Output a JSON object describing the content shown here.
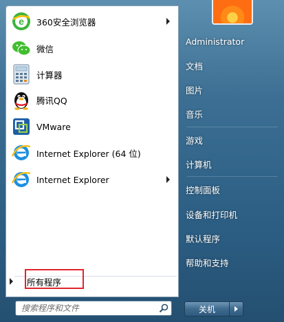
{
  "programs": [
    {
      "label": "360安全浏览器",
      "icon": "360-browser-icon",
      "has_submenu": true
    },
    {
      "label": "微信",
      "icon": "wechat-icon",
      "has_submenu": false
    },
    {
      "label": "计算器",
      "icon": "calculator-icon",
      "has_submenu": false
    },
    {
      "label": "腾讯QQ",
      "icon": "qq-penguin-icon",
      "has_submenu": false
    },
    {
      "label": "VMware",
      "icon": "vmware-icon",
      "has_submenu": false
    },
    {
      "label": "Internet Explorer (64 位)",
      "icon": "internet-explorer-icon",
      "has_submenu": false
    },
    {
      "label": "Internet Explorer",
      "icon": "internet-explorer-icon",
      "has_submenu": true
    }
  ],
  "all_programs": {
    "label": "所有程序"
  },
  "search": {
    "placeholder": "搜索程序和文件"
  },
  "right_menu": {
    "items": [
      "Administrator",
      "文档",
      "图片",
      "音乐",
      "游戏",
      "计算机",
      "控制面板",
      "设备和打印机",
      "默认程序",
      "帮助和支持"
    ]
  },
  "shutdown": {
    "label": "关机"
  },
  "colors": {
    "highlight": "#e0232b",
    "panel_blue": "#2c5e84"
  }
}
